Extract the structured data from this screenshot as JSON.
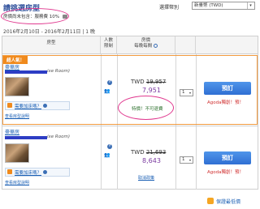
{
  "header": {
    "title": "請挑選房型",
    "tax_note": "房價尚未包含：服務費 10%",
    "tax_icon": "camera-icon"
  },
  "currency": {
    "label": "選擇幣別",
    "selected": "新臺幣 (TWD)"
  },
  "dates": {
    "text": "2016年2月10日 - 2016年2月11日 | 1 晚"
  },
  "columns": {
    "room_type": "房型",
    "occupancy": "人數\n限制",
    "price_line1": "房價",
    "price_line2": "每晚每間",
    "rooms_line1": "",
    "rooms_line2": ""
  },
  "rows": [
    {
      "badge": "超人氣！",
      "room_name": "豪華房",
      "room_name_en": "ixe Room)",
      "addon_label": "需要加床嗎？",
      "more_label": "查看房型說明",
      "old_currency": "TWD",
      "old_price": "19,957",
      "new_price": "7,951",
      "note": "特價！不可退費",
      "qty": "1",
      "book_label": "預訂",
      "agoda_note": "Agoda獨創！預！"
    },
    {
      "badge": "",
      "room_name": "豪華房",
      "room_name_en": "ixe Room)",
      "addon_label": "需要加床嗎？",
      "more_label": "查看房型說明",
      "old_currency": "TWD",
      "old_price": "21,693",
      "new_price": "8,643",
      "note": "取消政策",
      "qty": "1",
      "book_label": "預訂",
      "agoda_note": "Agoda獨創！預！"
    }
  ],
  "footer": {
    "guarantee": "保證最低價"
  },
  "colors": {
    "accent_orange": "#f08a1d",
    "price_purple": "#7b3aa0",
    "link_blue": "#1a5fb4",
    "highlight_pink": "#e0398f"
  }
}
